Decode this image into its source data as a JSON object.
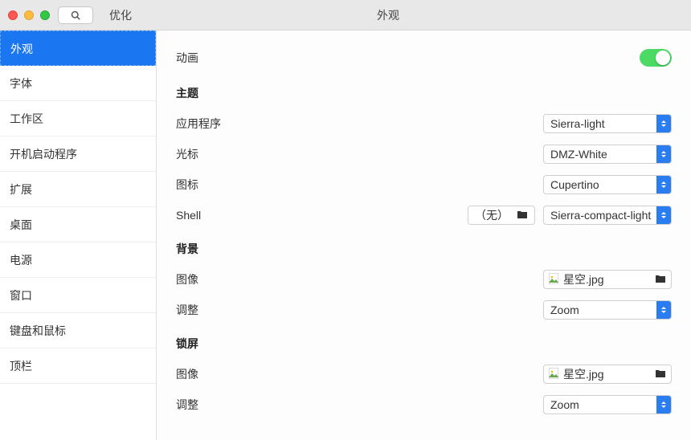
{
  "titlebar": {
    "app": "优化",
    "title": "外观"
  },
  "sidebar": {
    "items": [
      {
        "label": "外观",
        "selected": true
      },
      {
        "label": "字体"
      },
      {
        "label": "工作区"
      },
      {
        "label": "开机启动程序"
      },
      {
        "label": "扩展"
      },
      {
        "label": "桌面"
      },
      {
        "label": "电源"
      },
      {
        "label": "窗口"
      },
      {
        "label": "键盘和鼠标"
      },
      {
        "label": "顶栏"
      }
    ]
  },
  "content": {
    "animation": {
      "label": "动画",
      "enabled": true
    },
    "theme": {
      "heading": "主题",
      "app": {
        "label": "应用程序",
        "value": "Sierra-light"
      },
      "cursor": {
        "label": "光标",
        "value": "DMZ-White"
      },
      "icons": {
        "label": "图标",
        "value": "Cupertino"
      },
      "shell": {
        "label": "Shell",
        "file": "（无）",
        "value": "Sierra-compact-light"
      }
    },
    "background": {
      "heading": "背景",
      "image": {
        "label": "图像",
        "value": "星空.jpg"
      },
      "adjust": {
        "label": "调整",
        "value": "Zoom"
      }
    },
    "lockscreen": {
      "heading": "锁屏",
      "image": {
        "label": "图像",
        "value": "星空.jpg"
      },
      "adjust": {
        "label": "调整",
        "value": "Zoom"
      }
    }
  }
}
